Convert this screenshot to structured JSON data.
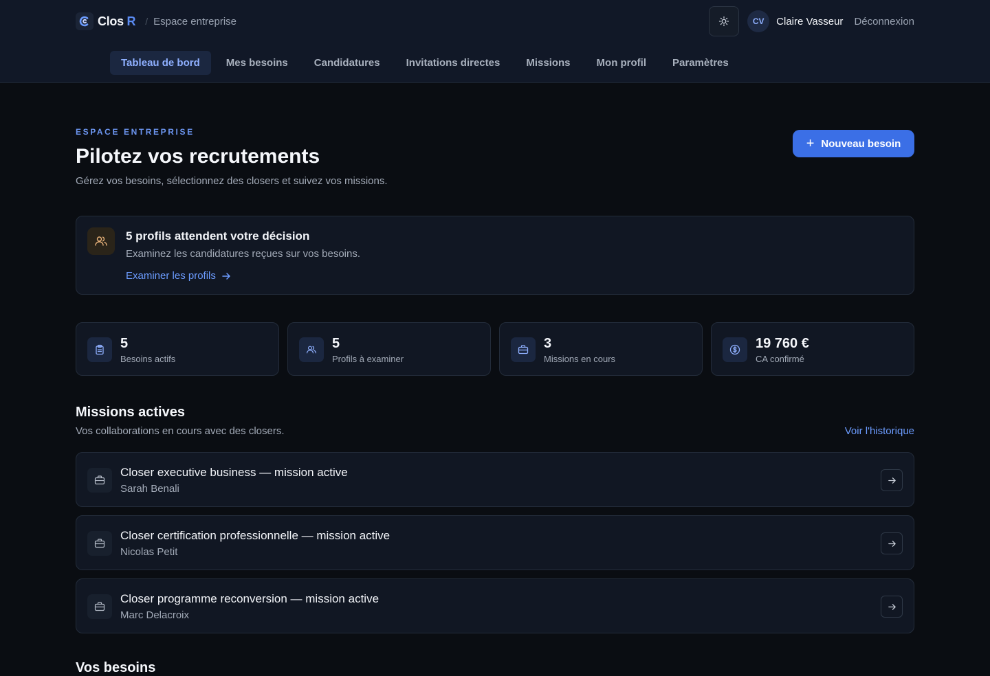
{
  "header": {
    "brand_main": "Clos",
    "brand_accent": "R",
    "crumb_sep": "/",
    "crumb": "Espace entreprise",
    "user_initials": "CV",
    "user_name": "Claire Vasseur",
    "logout": "Déconnexion"
  },
  "nav": [
    {
      "label": "Tableau de bord",
      "active": true
    },
    {
      "label": "Mes besoins"
    },
    {
      "label": "Candidatures"
    },
    {
      "label": "Invitations directes"
    },
    {
      "label": "Missions"
    },
    {
      "label": "Mon profil"
    },
    {
      "label": "Paramètres"
    }
  ],
  "hero": {
    "eyebrow": "ESPACE ENTREPRISE",
    "title": "Pilotez vos recrutements",
    "subtitle": "Gérez vos besoins, sélectionnez des closers et suivez vos missions.",
    "new_button": "Nouveau besoin",
    "new_button_icon": "+"
  },
  "alert": {
    "title": "5 profils attendent votre décision",
    "text": "Examinez les candidatures reçues sur vos besoins.",
    "link": "Examiner les profils",
    "icon": "users-icon"
  },
  "stats": [
    {
      "value": "5",
      "label": "Besoins actifs",
      "icon": "clipboard-icon"
    },
    {
      "value": "5",
      "label": "Profils à examiner",
      "icon": "users-icon"
    },
    {
      "value": "3",
      "label": "Missions en cours",
      "icon": "briefcase-icon"
    },
    {
      "value": "19 760 €",
      "label": "CA confirmé",
      "icon": "dollar-icon"
    }
  ],
  "missions_section": {
    "title": "Missions actives",
    "subtitle": "Vos collaborations en cours avec des closers.",
    "link": "Voir l'historique",
    "items": [
      {
        "title": "Closer executive business — mission active",
        "person": "Sarah Benali"
      },
      {
        "title": "Closer certification professionnelle — mission active",
        "person": "Nicolas Petit"
      },
      {
        "title": "Closer programme reconversion — mission active",
        "person": "Marc Delacroix"
      }
    ]
  },
  "besoins_section": {
    "title": "Vos besoins"
  },
  "colors": {
    "background": "#0a0d12",
    "surface": "#111723",
    "accent": "#3b6fe6",
    "link": "#6c9cff"
  }
}
